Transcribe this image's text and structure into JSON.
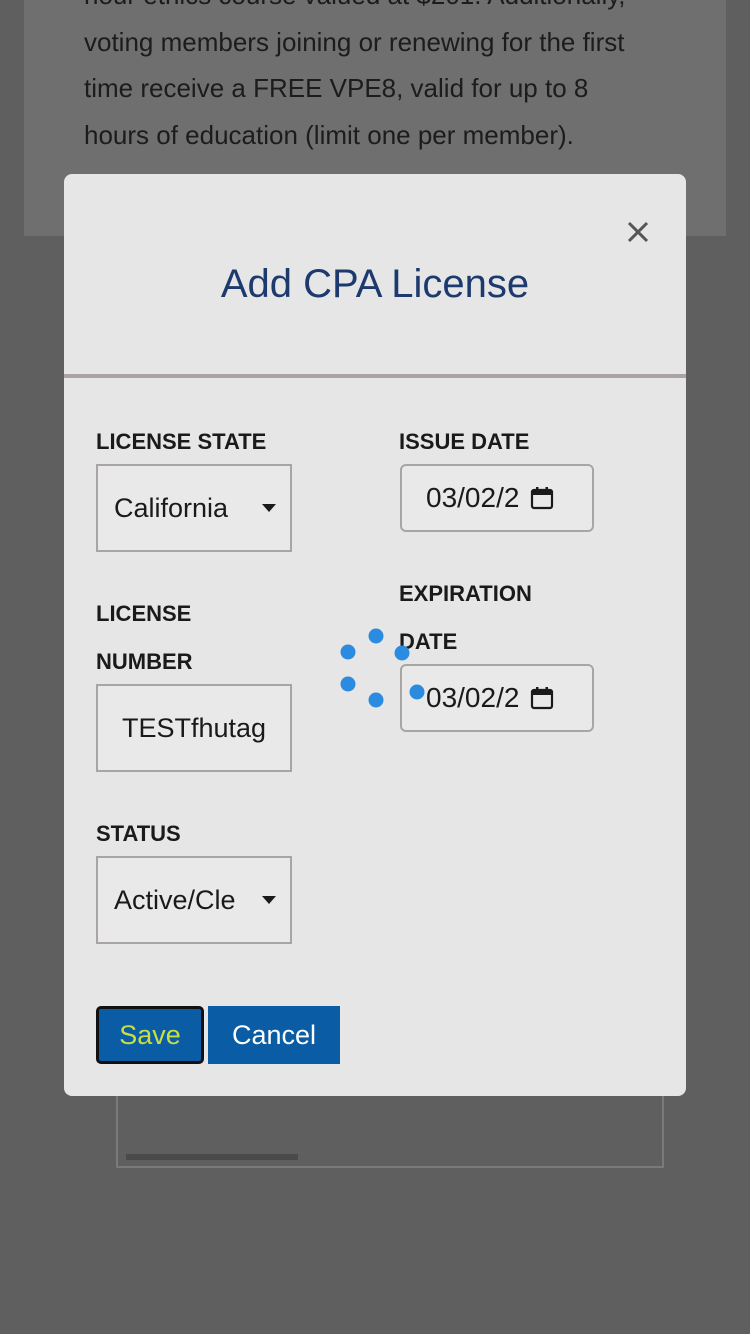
{
  "background": {
    "text_lines": [
      "hour ethics course valued at $201. Additionally,",
      "voting members joining or renewing for the first",
      "time receive a FREE VPE8, valid for up to 8",
      "hours of education (limit one per member)."
    ]
  },
  "modal": {
    "title": "Add CPA License",
    "close_icon": "close-icon",
    "fields": {
      "license_state": {
        "label": "LICENSE STATE",
        "value": "California"
      },
      "issue_date": {
        "label": "ISSUE DATE",
        "value": "03/02/2"
      },
      "license_number": {
        "label_line1": "LICENSE",
        "label_line2": "NUMBER",
        "value": "TESTfhutag"
      },
      "expiration_date": {
        "label_line1": "EXPIRATION",
        "label_line2": "DATE",
        "value": "03/02/2"
      },
      "status": {
        "label": "STATUS",
        "value": "Active/Cle"
      }
    },
    "buttons": {
      "save": "Save",
      "cancel": "Cancel"
    }
  },
  "colors": {
    "title": "#1d3a6e",
    "button_bg": "#0a5ca5",
    "save_text": "#c8de42",
    "spinner": "#2b8be0",
    "overlay": "#5f5f5f"
  }
}
